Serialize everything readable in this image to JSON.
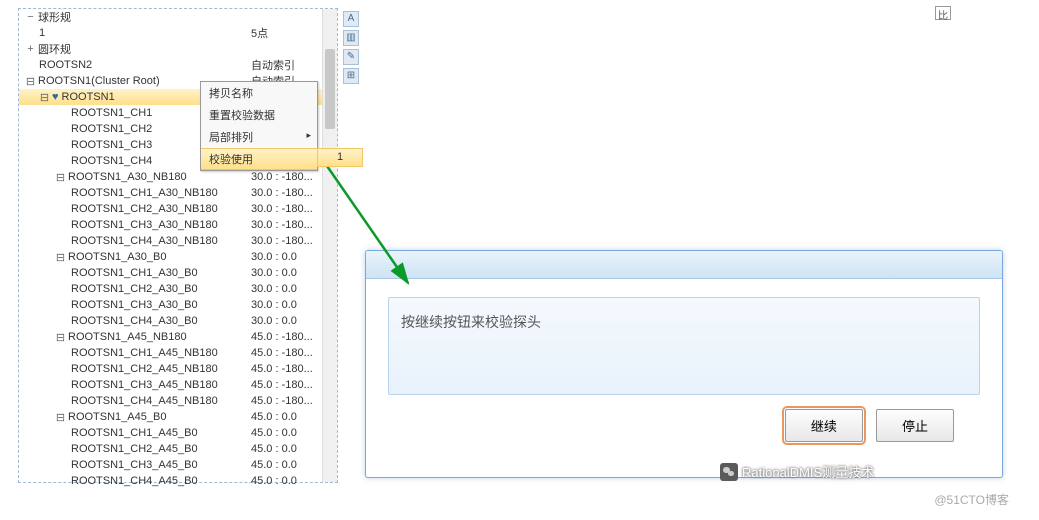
{
  "header": {
    "sphere_gauge": "球形规",
    "sphere_gauge_count": "1",
    "sphere_gauge_points": "5点",
    "ring_gauge": "圆环规"
  },
  "tree": {
    "rootsn2": {
      "name": "ROOTSN2",
      "value": "自动索引"
    },
    "rootsn1_cluster": {
      "name": "ROOTSN1(Cluster Root)",
      "value": "自动索引"
    },
    "rootsn1": {
      "name": "ROOTSN1"
    },
    "ch": [
      {
        "name": "ROOTSN1_CH1"
      },
      {
        "name": "ROOTSN1_CH2"
      },
      {
        "name": "ROOTSN1_CH3"
      },
      {
        "name": "ROOTSN1_CH4"
      }
    ],
    "a30nb180": {
      "name": "ROOTSN1_A30_NB180",
      "value": "30.0 : -180..."
    },
    "a30nb180_ch": [
      {
        "name": "ROOTSN1_CH1_A30_NB180",
        "value": "30.0 : -180..."
      },
      {
        "name": "ROOTSN1_CH2_A30_NB180",
        "value": "30.0 : -180..."
      },
      {
        "name": "ROOTSN1_CH3_A30_NB180",
        "value": "30.0 : -180..."
      },
      {
        "name": "ROOTSN1_CH4_A30_NB180",
        "value": "30.0 : -180..."
      }
    ],
    "a30b0": {
      "name": "ROOTSN1_A30_B0",
      "value": "30.0 : 0.0"
    },
    "a30b0_ch": [
      {
        "name": "ROOTSN1_CH1_A30_B0",
        "value": "30.0 : 0.0"
      },
      {
        "name": "ROOTSN1_CH2_A30_B0",
        "value": "30.0 : 0.0"
      },
      {
        "name": "ROOTSN1_CH3_A30_B0",
        "value": "30.0 : 0.0"
      },
      {
        "name": "ROOTSN1_CH4_A30_B0",
        "value": "30.0 : 0.0"
      }
    ],
    "a45nb180": {
      "name": "ROOTSN1_A45_NB180",
      "value": "45.0 : -180..."
    },
    "a45nb180_ch": [
      {
        "name": "ROOTSN1_CH1_A45_NB180",
        "value": "45.0 : -180..."
      },
      {
        "name": "ROOTSN1_CH2_A45_NB180",
        "value": "45.0 : -180..."
      },
      {
        "name": "ROOTSN1_CH3_A45_NB180",
        "value": "45.0 : -180..."
      },
      {
        "name": "ROOTSN1_CH4_A45_NB180",
        "value": "45.0 : -180..."
      }
    ],
    "a45b0": {
      "name": "ROOTSN1_A45_B0",
      "value": "45.0 : 0.0"
    },
    "a45b0_ch": [
      {
        "name": "ROOTSN1_CH1_A45_B0",
        "value": "45.0 : 0.0"
      },
      {
        "name": "ROOTSN1_CH2_A45_B0",
        "value": "45.0 : 0.0"
      },
      {
        "name": "ROOTSN1_CH3_A45_B0",
        "value": "45.0 : 0.0"
      },
      {
        "name": "ROOTSN1_CH4_A45_B0",
        "value": "45.0 : 0.0"
      }
    ]
  },
  "context_menu": {
    "copy_name": "拷贝名称",
    "reset_calib": "重置校验数据",
    "local_sort": "局部排列",
    "calib_use": "校验使用",
    "submenu_value": "1"
  },
  "dialog": {
    "message": "按继续按钮来校验探头",
    "continue_btn": "继续",
    "stop_btn": "停止"
  },
  "credits": {
    "wechat": "RationalDMIS测量技术",
    "footer": "@51CTO博客"
  },
  "topright": "比"
}
